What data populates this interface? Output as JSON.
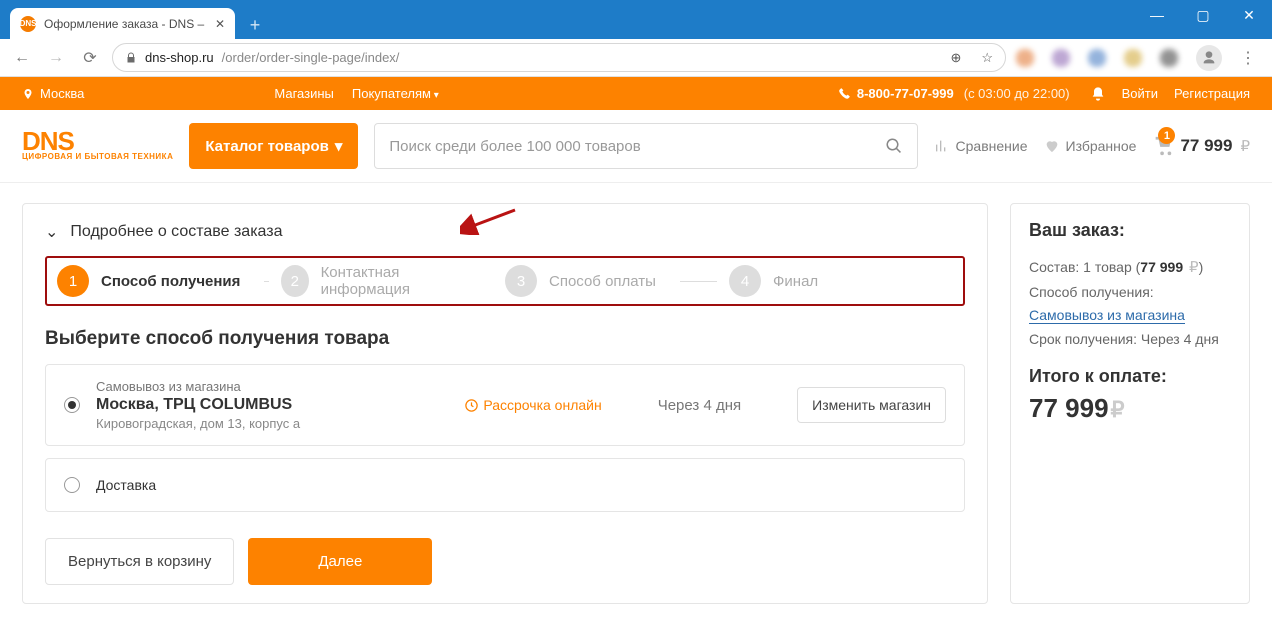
{
  "browser": {
    "tab_title": "Оформление заказа - DNS – ин",
    "new_tab_icon": "+",
    "url_domain": "dns-shop.ru",
    "url_path": "/order/order-single-page/index/",
    "lock_icon": "lock-icon",
    "nav": {
      "back": "←",
      "forward": "→",
      "reload": "↻",
      "install": "⊕",
      "star": "☆",
      "avatar": "◯",
      "menu": "⋮"
    }
  },
  "topbar": {
    "city": "Москва",
    "menu": [
      "Магазины",
      "Покупателям"
    ],
    "phone": "8-800-77-07-999",
    "hours": "(c 03:00 до 22:00)",
    "bell_icon": "bell-icon",
    "login": "Войти",
    "register": "Регистрация"
  },
  "header": {
    "logo_main": "DNS",
    "logo_sub": "ЦИФРОВАЯ И\nБЫТОВАЯ ТЕХНИКА",
    "catalog_btn": "Каталог товаров",
    "search_placeholder": "Поиск среди более 100 000 товаров",
    "compare": "Сравнение",
    "favorites": "Избранное",
    "cart_count": "1",
    "cart_total": "77 999",
    "rub": "₽"
  },
  "order": {
    "expand_row": "Подробнее о составе заказа",
    "steps": [
      {
        "n": "1",
        "label": "Способ получения"
      },
      {
        "n": "2",
        "label": "Контактная информация"
      },
      {
        "n": "3",
        "label": "Способ оплаты"
      },
      {
        "n": "4",
        "label": "Финал"
      }
    ],
    "section_title": "Выберите способ получения товара",
    "pickup": {
      "heading": "Самовывоз из магазина",
      "store": "Москва, ТРЦ COLUMBUS",
      "address": "Кировоградская, дом 13, корпус а",
      "installment": "Рассрочка онлайн",
      "eta": "Через 4 дня",
      "change_btn": "Изменить магазин"
    },
    "delivery_label": "Доставка",
    "back_btn": "Вернуться в корзину",
    "next_btn": "Далее"
  },
  "summary": {
    "title": "Ваш заказ:",
    "contents_label": "Состав:",
    "contents_value": "1 товар",
    "contents_price": "77 999",
    "method_label": "Способ получения:",
    "method_link": "Самовывоз из магазина",
    "eta_label": "Срок получения:",
    "eta_value": "Через 4 дня",
    "total_label": "Итого к оплате:",
    "total_value": "77 999",
    "rub": "₽"
  }
}
